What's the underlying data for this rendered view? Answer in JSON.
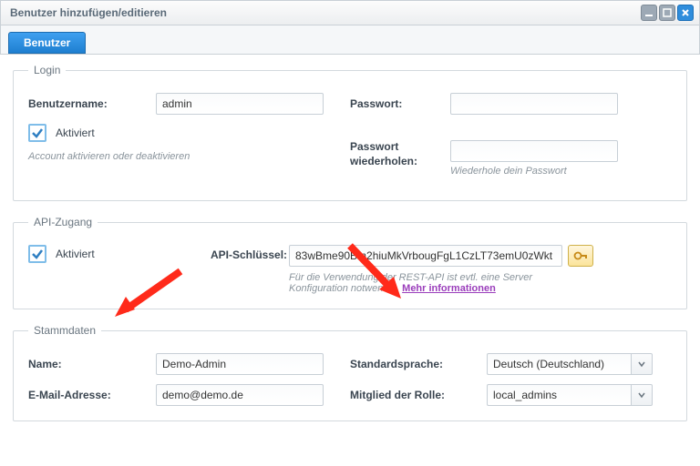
{
  "titlebar": {
    "title": "Benutzer hinzufügen/editieren"
  },
  "tabs": {
    "user": "Benutzer"
  },
  "login": {
    "legend": "Login",
    "username_label": "Benutzername:",
    "username_value": "admin",
    "activated_label": "Aktiviert",
    "activated_hint": "Account aktivieren oder deaktivieren",
    "password_label": "Passwort:",
    "password_repeat_label": "Passwort wiederholen:",
    "password_repeat_hint": "Wiederhole dein Passwort"
  },
  "api": {
    "legend": "API-Zugang",
    "activated_label": "Aktiviert",
    "key_label": "API-Schlüssel:",
    "key_value": "83wBme90Bm2hiuMkVrbougFgL1CzLT73emU0zWkt",
    "hint_prefix": "Für die Verwendung der REST-API ist evtl. eine Server Konfiguration notwendig. ",
    "hint_link": "Mehr informationen"
  },
  "master": {
    "legend": "Stammdaten",
    "name_label": "Name:",
    "name_value": "Demo-Admin",
    "email_label": "E-Mail-Adresse:",
    "email_value": "demo@demo.de",
    "lang_label": "Standardsprache:",
    "lang_value": "Deutsch (Deutschland)",
    "role_label": "Mitglied der Rolle:",
    "role_value": "local_admins"
  }
}
